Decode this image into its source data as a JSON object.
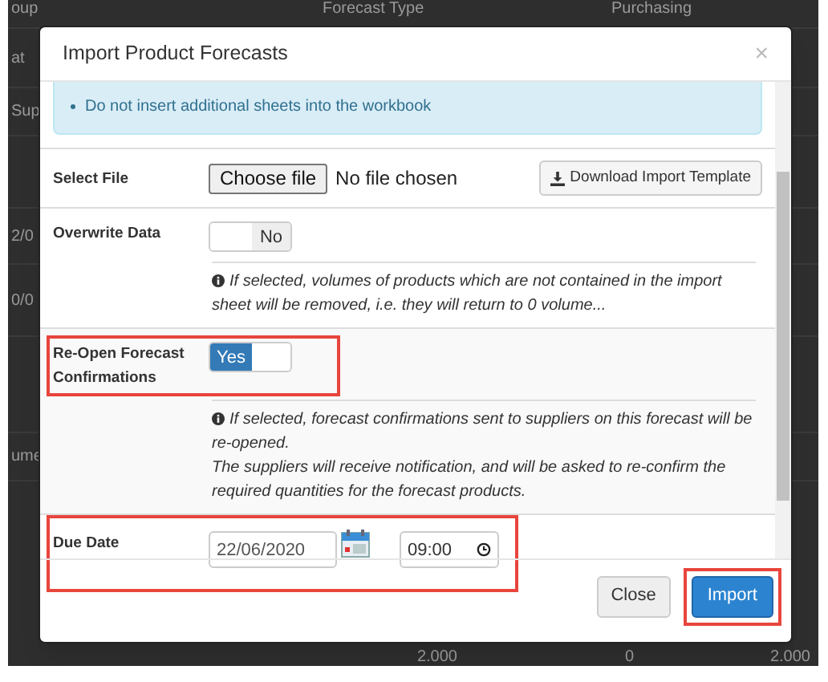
{
  "backdrop": {
    "header": [
      "oup",
      "Forecast Type",
      "Purchasing"
    ],
    "left_cells": [
      "at",
      "Sup",
      "2/0",
      "0/0",
      "ume"
    ],
    "footer_cells": [
      "2.000",
      "0",
      "2.000"
    ]
  },
  "dialog": {
    "title": "Import Product Forecasts",
    "close": "×",
    "notice": "Do not insert additional sheets into the workbook",
    "fields": [
      {
        "kind": "file",
        "label": "Select File",
        "button": "Choose file",
        "value": "No file chosen",
        "action": "Download Import Template",
        "highlighted": false
      },
      {
        "kind": "toggle",
        "label": "Overwrite Data",
        "on": false,
        "text": "No",
        "note": [
          "If selected, volumes of products which are not contained in the import sheet will be removed, i.e. they will return to 0 volume..."
        ],
        "highlighted": false
      },
      {
        "kind": "toggle",
        "label": "Re-Open Forecast Confirmations",
        "on": true,
        "text": "Yes",
        "note": [
          "If selected, forecast confirmations sent to suppliers on this forecast will be re-opened.",
          "The suppliers will receive notification, and will be asked to re-confirm the required quantities for the forecast products."
        ],
        "highlighted": true
      },
      {
        "kind": "datetime",
        "label": "Due Date",
        "date": "22/06/2020",
        "time": "09:00",
        "highlighted": true
      }
    ],
    "buttons": [
      {
        "label": "Close",
        "primary": false,
        "highlighted": false
      },
      {
        "label": "Import",
        "primary": true,
        "highlighted": true
      }
    ]
  }
}
